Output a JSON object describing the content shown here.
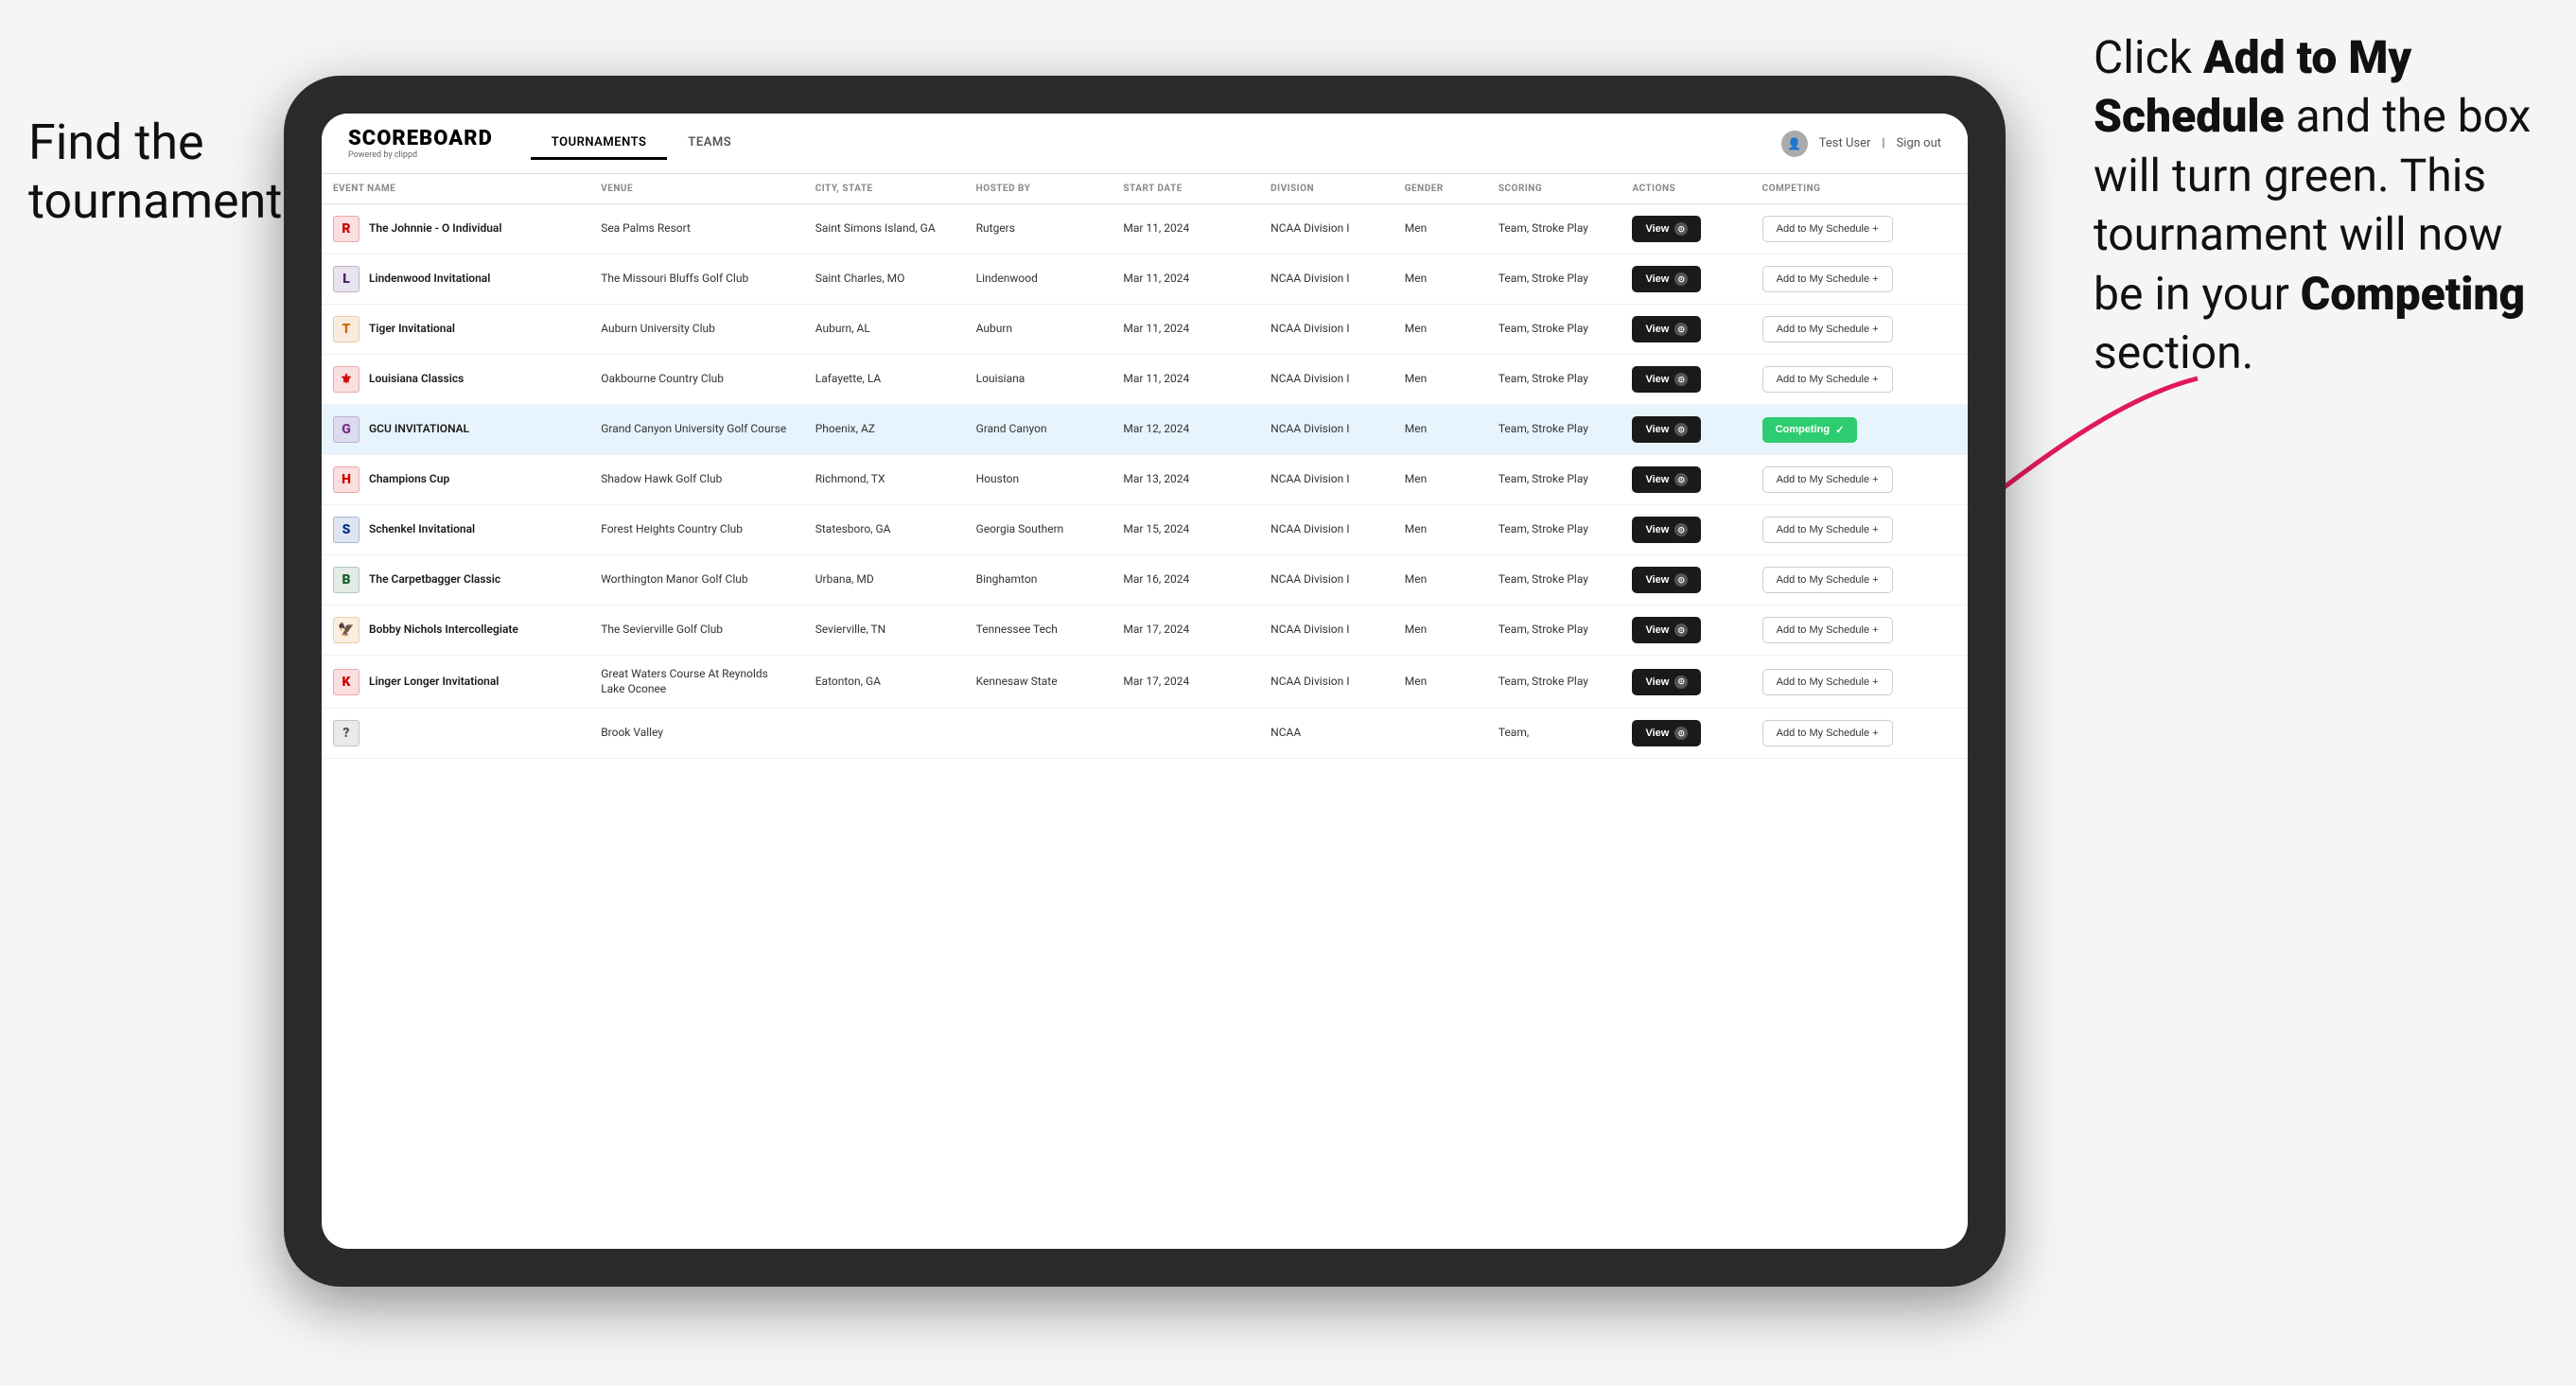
{
  "annotations": {
    "left_text_line1": "Find the",
    "left_text_line2": "tournament.",
    "right_text": "Click ",
    "right_bold1": "Add to My Schedule",
    "right_mid": " and the box will turn green. This tournament will now be in your ",
    "right_bold2": "Competing",
    "right_end": " section."
  },
  "navbar": {
    "logo": "SCOREBOARD",
    "logo_sub": "Powered by clippd",
    "tabs": [
      "TOURNAMENTS",
      "TEAMS"
    ],
    "active_tab": "TOURNAMENTS",
    "user": "Test User",
    "sign_out": "Sign out"
  },
  "table": {
    "columns": [
      "EVENT NAME",
      "VENUE",
      "CITY, STATE",
      "HOSTED BY",
      "START DATE",
      "DIVISION",
      "GENDER",
      "SCORING",
      "ACTIONS",
      "COMPETING"
    ],
    "rows": [
      {
        "logo_color": "#cc0000",
        "logo_letter": "R",
        "event_name": "The Johnnie - O Individual",
        "venue": "Sea Palms Resort",
        "city_state": "Saint Simons Island, GA",
        "hosted_by": "Rutgers",
        "start_date": "Mar 11, 2024",
        "division": "NCAA Division I",
        "gender": "Men",
        "scoring": "Team, Stroke Play",
        "action": "View",
        "competing_status": "add",
        "competing_label": "Add to My Schedule +"
      },
      {
        "logo_color": "#4a1c6b",
        "logo_letter": "L",
        "event_name": "Lindenwood Invitational",
        "venue": "The Missouri Bluffs Golf Club",
        "city_state": "Saint Charles, MO",
        "hosted_by": "Lindenwood",
        "start_date": "Mar 11, 2024",
        "division": "NCAA Division I",
        "gender": "Men",
        "scoring": "Team, Stroke Play",
        "action": "View",
        "competing_status": "add",
        "competing_label": "Add to My Schedule +"
      },
      {
        "logo_color": "#cc6600",
        "logo_letter": "T",
        "event_name": "Tiger Invitational",
        "venue": "Auburn University Club",
        "city_state": "Auburn, AL",
        "hosted_by": "Auburn",
        "start_date": "Mar 11, 2024",
        "division": "NCAA Division I",
        "gender": "Men",
        "scoring": "Team, Stroke Play",
        "action": "View",
        "competing_status": "add",
        "competing_label": "Add to My Schedule +"
      },
      {
        "logo_color": "#cc0000",
        "logo_letter": "⚜",
        "event_name": "Louisiana Classics",
        "venue": "Oakbourne Country Club",
        "city_state": "Lafayette, LA",
        "hosted_by": "Louisiana",
        "start_date": "Mar 11, 2024",
        "division": "NCAA Division I",
        "gender": "Men",
        "scoring": "Team, Stroke Play",
        "action": "View",
        "competing_status": "add",
        "competing_label": "Add to My Schedule +"
      },
      {
        "logo_color": "#7b2d8b",
        "logo_letter": "G",
        "event_name": "GCU INVITATIONAL",
        "venue": "Grand Canyon University Golf Course",
        "city_state": "Phoenix, AZ",
        "hosted_by": "Grand Canyon",
        "start_date": "Mar 12, 2024",
        "division": "NCAA Division I",
        "gender": "Men",
        "scoring": "Team, Stroke Play",
        "action": "View",
        "competing_status": "competing",
        "competing_label": "Competing",
        "highlighted": true
      },
      {
        "logo_color": "#cc0000",
        "logo_letter": "H",
        "event_name": "Champions Cup",
        "venue": "Shadow Hawk Golf Club",
        "city_state": "Richmond, TX",
        "hosted_by": "Houston",
        "start_date": "Mar 13, 2024",
        "division": "NCAA Division I",
        "gender": "Men",
        "scoring": "Team, Stroke Play",
        "action": "View",
        "competing_status": "add",
        "competing_label": "Add to My Schedule +"
      },
      {
        "logo_color": "#003087",
        "logo_letter": "S",
        "event_name": "Schenkel Invitational",
        "venue": "Forest Heights Country Club",
        "city_state": "Statesboro, GA",
        "hosted_by": "Georgia Southern",
        "start_date": "Mar 15, 2024",
        "division": "NCAA Division I",
        "gender": "Men",
        "scoring": "Team, Stroke Play",
        "action": "View",
        "competing_status": "add",
        "competing_label": "Add to My Schedule +"
      },
      {
        "logo_color": "#1a5e2a",
        "logo_letter": "B",
        "event_name": "The Carpetbagger Classic",
        "venue": "Worthington Manor Golf Club",
        "city_state": "Urbana, MD",
        "hosted_by": "Binghamton",
        "start_date": "Mar 16, 2024",
        "division": "NCAA Division I",
        "gender": "Men",
        "scoring": "Team, Stroke Play",
        "action": "View",
        "competing_status": "add",
        "competing_label": "Add to My Schedule +"
      },
      {
        "logo_color": "#cc7700",
        "logo_letter": "🦅",
        "event_name": "Bobby Nichols Intercollegiate",
        "venue": "The Sevierville Golf Club",
        "city_state": "Sevierville, TN",
        "hosted_by": "Tennessee Tech",
        "start_date": "Mar 17, 2024",
        "division": "NCAA Division I",
        "gender": "Men",
        "scoring": "Team, Stroke Play",
        "action": "View",
        "competing_status": "add",
        "competing_label": "Add to My Schedule +"
      },
      {
        "logo_color": "#cc0000",
        "logo_letter": "K",
        "event_name": "Linger Longer Invitational",
        "venue": "Great Waters Course At Reynolds Lake Oconee",
        "city_state": "Eatonton, GA",
        "hosted_by": "Kennesaw State",
        "start_date": "Mar 17, 2024",
        "division": "NCAA Division I",
        "gender": "Men",
        "scoring": "Team, Stroke Play",
        "action": "View",
        "competing_status": "add",
        "competing_label": "Add to My Schedule +"
      },
      {
        "logo_color": "#555555",
        "logo_letter": "?",
        "event_name": "",
        "venue": "Brook Valley",
        "city_state": "",
        "hosted_by": "",
        "start_date": "",
        "division": "NCAA",
        "gender": "",
        "scoring": "Team,",
        "action": "View",
        "competing_status": "add",
        "competing_label": "Add to My Schedule +"
      }
    ]
  }
}
